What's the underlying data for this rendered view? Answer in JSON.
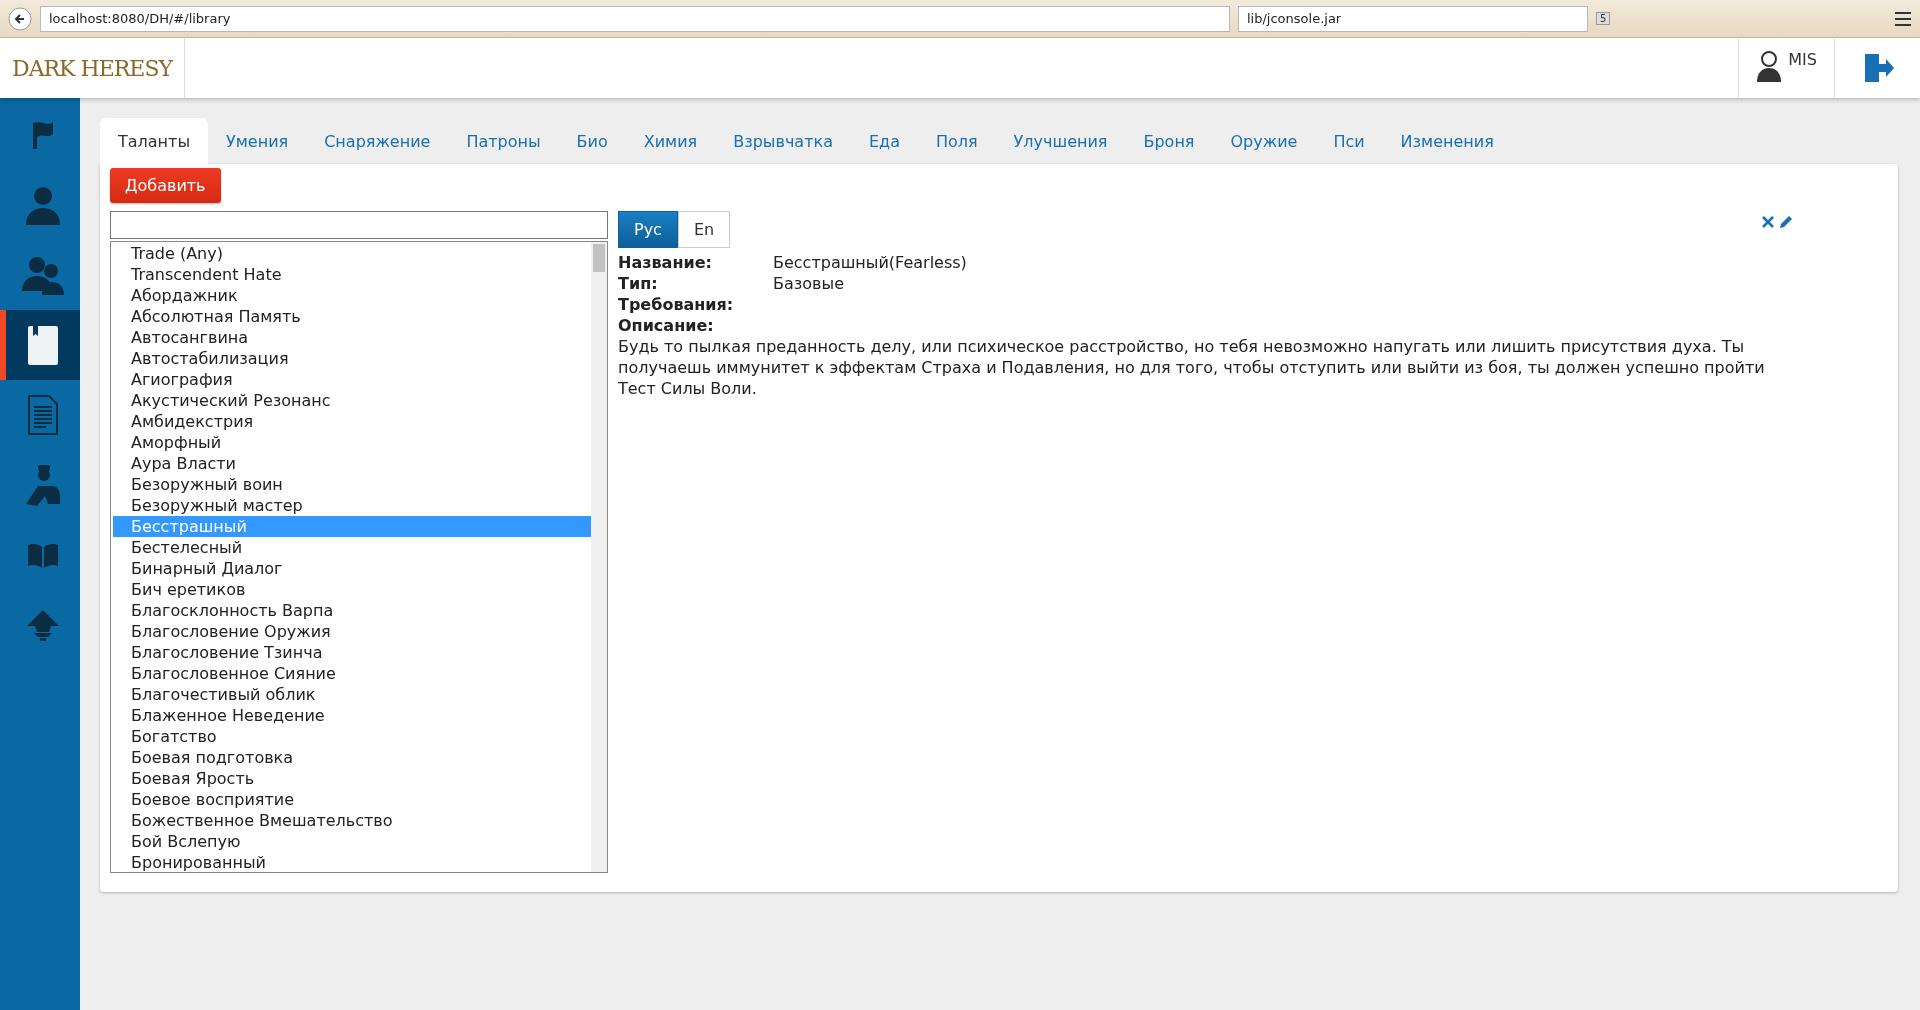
{
  "browser": {
    "url": "localhost:8080/DH/#/library",
    "search": "lib/jconsole.jar",
    "badge": "5"
  },
  "header": {
    "logo": "DARK HERESY",
    "user": "MIS"
  },
  "sidebar": {
    "items": [
      {
        "kind": "flag",
        "selected": false
      },
      {
        "kind": "user",
        "selected": false
      },
      {
        "kind": "users",
        "selected": false
      },
      {
        "kind": "book",
        "selected": true
      },
      {
        "kind": "document",
        "selected": false
      },
      {
        "kind": "soldier",
        "selected": false
      },
      {
        "kind": "open-book",
        "selected": false
      },
      {
        "kind": "emblem",
        "selected": false
      }
    ]
  },
  "tabs": [
    {
      "label": "Таланты",
      "selected": true
    },
    {
      "label": "Умения",
      "selected": false
    },
    {
      "label": "Снаряжение",
      "selected": false
    },
    {
      "label": "Патроны",
      "selected": false
    },
    {
      "label": "Био",
      "selected": false
    },
    {
      "label": "Химия",
      "selected": false
    },
    {
      "label": "Взрывчатка",
      "selected": false
    },
    {
      "label": "Еда",
      "selected": false
    },
    {
      "label": "Поля",
      "selected": false
    },
    {
      "label": "Улучшения",
      "selected": false
    },
    {
      "label": "Броня",
      "selected": false
    },
    {
      "label": "Оружие",
      "selected": false
    },
    {
      "label": "Пси",
      "selected": false
    },
    {
      "label": "Изменения",
      "selected": false
    }
  ],
  "add_button": "Добавить",
  "list": {
    "items": [
      {
        "label": "Trade (Any)",
        "selected": false
      },
      {
        "label": "Transcendent Hate",
        "selected": false
      },
      {
        "label": "Абордажник",
        "selected": false
      },
      {
        "label": "Абсолютная Память",
        "selected": false
      },
      {
        "label": "Автосангвина",
        "selected": false
      },
      {
        "label": "Автостабилизация",
        "selected": false
      },
      {
        "label": "Агиография",
        "selected": false
      },
      {
        "label": "Акустический Резонанс",
        "selected": false
      },
      {
        "label": "Амбидекстрия",
        "selected": false
      },
      {
        "label": "Аморфный",
        "selected": false
      },
      {
        "label": "Аура Власти",
        "selected": false
      },
      {
        "label": "Безоружный воин",
        "selected": false
      },
      {
        "label": "Безоружный мастер",
        "selected": false
      },
      {
        "label": "Бесстрашный",
        "selected": true
      },
      {
        "label": "Бестелесный",
        "selected": false
      },
      {
        "label": "Бинарный Диалог",
        "selected": false
      },
      {
        "label": "Бич еретиков",
        "selected": false
      },
      {
        "label": "Благосклонность Варпа",
        "selected": false
      },
      {
        "label": "Благословение Оружия",
        "selected": false
      },
      {
        "label": "Благословение Тзинча",
        "selected": false
      },
      {
        "label": "Благословенное Сияние",
        "selected": false
      },
      {
        "label": "Благочестивый облик",
        "selected": false
      },
      {
        "label": "Блаженное Неведение",
        "selected": false
      },
      {
        "label": "Богатство",
        "selected": false
      },
      {
        "label": "Боевая подготовка",
        "selected": false
      },
      {
        "label": "Боевая Ярость",
        "selected": false
      },
      {
        "label": "Боевое восприятие",
        "selected": false
      },
      {
        "label": "Божественное Вмешательство",
        "selected": false
      },
      {
        "label": "Бой Вслепую",
        "selected": false
      },
      {
        "label": "Бронированный",
        "selected": false
      }
    ]
  },
  "languages": [
    {
      "label": "Рус",
      "selected": true
    },
    {
      "label": "En",
      "selected": false
    }
  ],
  "details": {
    "fields": [
      {
        "label": "Название:",
        "value": "Бесстрашный(Fearless)"
      },
      {
        "label": "Тип:",
        "value": "Базовые"
      },
      {
        "label": "Требования:"
      },
      {
        "label": "Описание:"
      }
    ],
    "description": "Будь то пылкая преданность делу, или психическое расстройство, но тебя невозможно напугать или лишить присутствия духа. Ты получаешь иммунитет к эффектам Страха и Подавления, но для того, чтобы отступить или выйти из боя, ты должен успешно пройти Тест Силы Воли."
  }
}
